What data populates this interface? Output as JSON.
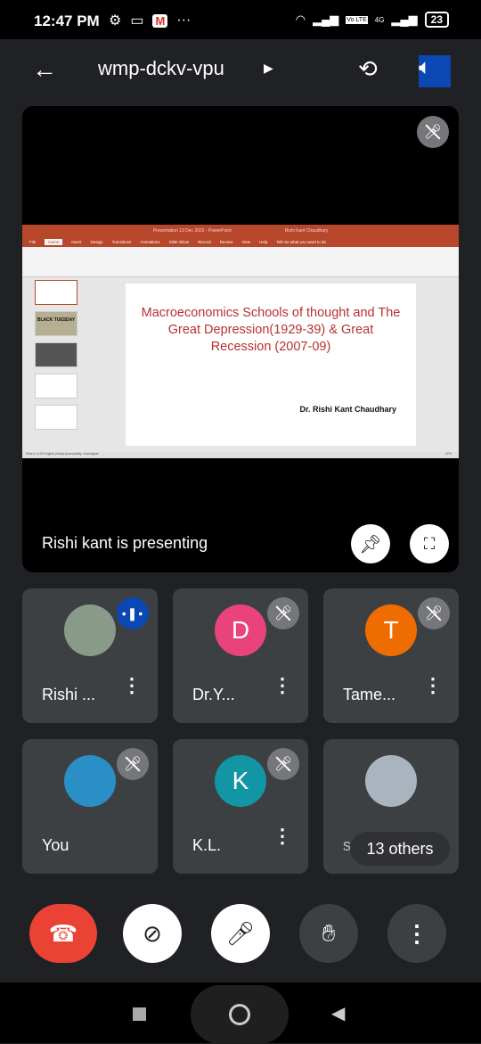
{
  "status_bar": {
    "time": "12:47 PM",
    "battery": "23",
    "network": "4G",
    "volte": "Vo LTE"
  },
  "app_bar": {
    "meeting_code": "wmp-dckv-vpu"
  },
  "stage": {
    "presenting_text": "Rishi kant is presenting",
    "ppt": {
      "window_title": "Presentation 13 Dec 2022 - PowerPoint",
      "user": "Rishi Kant Chaudhary",
      "tabs": [
        "File",
        "Home",
        "Insert",
        "Design",
        "Transitions",
        "Animations",
        "Slide Show",
        "Record",
        "Review",
        "View",
        "Help",
        "Tell me what you want to do"
      ],
      "slide_title": "Macroeconomics Schools of thought and The Great Depression(1929-39) & Great Recession (2007-09)",
      "slide_author": "Dr. Rishi Kant Chaudhary",
      "thumb_text": "BLACK TUESDAY",
      "status": "Slide 1 of 20   English (India)   Accessibility: Investigate",
      "zoom": "47%"
    }
  },
  "participants": [
    {
      "name": "Rishi ...",
      "initial": "",
      "color": "#8a9a8a",
      "state": "speaking"
    },
    {
      "name": "Dr.Y...",
      "initial": "D",
      "color": "#e8437a",
      "state": "muted"
    },
    {
      "name": "Tame...",
      "initial": "T",
      "color": "#ef6c00",
      "state": "muted"
    },
    {
      "name": "You",
      "initial": "",
      "color": "#2a8fc7",
      "state": "muted"
    },
    {
      "name": "K.L.",
      "initial": "K",
      "color": "#1296a3",
      "state": "muted"
    },
    {
      "name": "sa",
      "initial": "",
      "color": "#a9b4bf",
      "state": ""
    }
  ],
  "others_label": "13 others",
  "colors": {
    "end_call": "#ea4335",
    "background": "#202124",
    "tile": "#3c4043"
  }
}
